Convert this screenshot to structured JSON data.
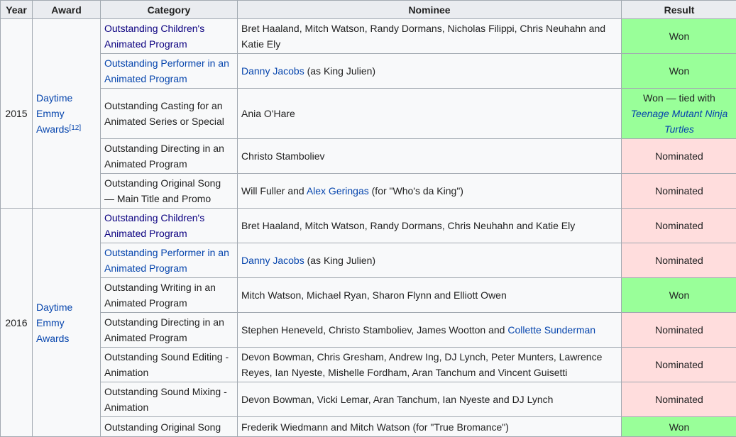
{
  "headers": {
    "year": "Year",
    "award": "Award",
    "category": "Category",
    "nominee": "Nominee",
    "result": "Result"
  },
  "groups": [
    {
      "year": "2015",
      "award_l1": "Daytime",
      "award_l2": "Emmy",
      "award_l3": "Awards",
      "ref": "[12]"
    },
    {
      "year": "2016",
      "award_l1": "Daytime",
      "award_l2": "Emmy",
      "award_l3": "Awards"
    }
  ],
  "rows": [
    {
      "cat_l1": "Outstanding Children's",
      "cat_l2": "Animated Program",
      "nominee": "Bret Haaland, Mitch Watson, Randy Dormans, Nicholas Filippi, Chris Neuhahn and",
      "nominee_l2": "Katie Ely",
      "result": "Won"
    },
    {
      "cat_l1": "Outstanding Performer in an",
      "cat_l2": "Animated Program",
      "nominee_link": "Danny Jacobs",
      "nominee_rest": " (as King Julien)",
      "result": "Won"
    },
    {
      "cat_l1": "Outstanding Casting for an",
      "cat_l2": "Animated Series or Special",
      "nominee": "Ania O'Hare",
      "result": "Won — tied with",
      "result_link_l1": "Teenage Mutant Ninja",
      "result_link_l2": "Turtles"
    },
    {
      "cat_l1": "Outstanding Directing in an",
      "cat_l2": "Animated Program",
      "nominee": "Christo Stamboliev",
      "result": "Nominated"
    },
    {
      "cat_l1": "Outstanding Original Song",
      "cat_l2": "— Main Title and Promo",
      "nominee_pre": "Will Fuller and ",
      "nominee_link": "Alex Geringas",
      "nominee_rest": " (for \"Who's da King\")",
      "result": "Nominated"
    },
    {
      "cat_l1": "Outstanding Children's",
      "cat_l2": "Animated Program",
      "nominee": "Bret Haaland, Mitch Watson, Randy Dormans, Chris Neuhahn and Katie Ely",
      "result": "Nominated"
    },
    {
      "cat_l1": "Outstanding Performer in an",
      "cat_l2": "Animated Program",
      "nominee_link": "Danny Jacobs",
      "nominee_rest": " (as King Julien)",
      "result": "Nominated"
    },
    {
      "cat_l1": "Outstanding Writing in an",
      "cat_l2": "Animated Program",
      "nominee": "Mitch Watson, Michael Ryan, Sharon Flynn and Elliott Owen",
      "result": "Won"
    },
    {
      "cat_l1": "Outstanding Directing in an",
      "cat_l2": "Animated Program",
      "nominee_pre": "Stephen Heneveld, Christo Stamboliev, James Wootton and ",
      "nominee_link": "Collette Sunderman",
      "result": "Nominated"
    },
    {
      "cat_l1": "Outstanding Sound Editing -",
      "cat_l2": "Animation",
      "nominee": "Devon Bowman, Chris Gresham, Andrew Ing, DJ Lynch, Peter Munters, Lawrence",
      "nominee_l2": "Reyes, Ian Nyeste, Mishelle Fordham, Aran Tanchum and Vincent Guisetti",
      "result": "Nominated"
    },
    {
      "cat_l1": "Outstanding Sound Mixing -",
      "cat_l2": "Animation",
      "nominee": "Devon Bowman, Vicki Lemar, Aran Tanchum, Ian Nyeste and DJ Lynch",
      "result": "Nominated"
    },
    {
      "cat_l1": "Outstanding Original Song",
      "nominee": "Frederik Wiedmann and Mitch Watson (for \"True Bromance\")",
      "result": "Won"
    }
  ],
  "colors": {
    "won": "#99ff99",
    "nominated": "#ffdddd",
    "link": "#0645ad",
    "visited_link": "#0b0080",
    "border": "#a2a9b1",
    "header_bg": "#eaecf0"
  }
}
